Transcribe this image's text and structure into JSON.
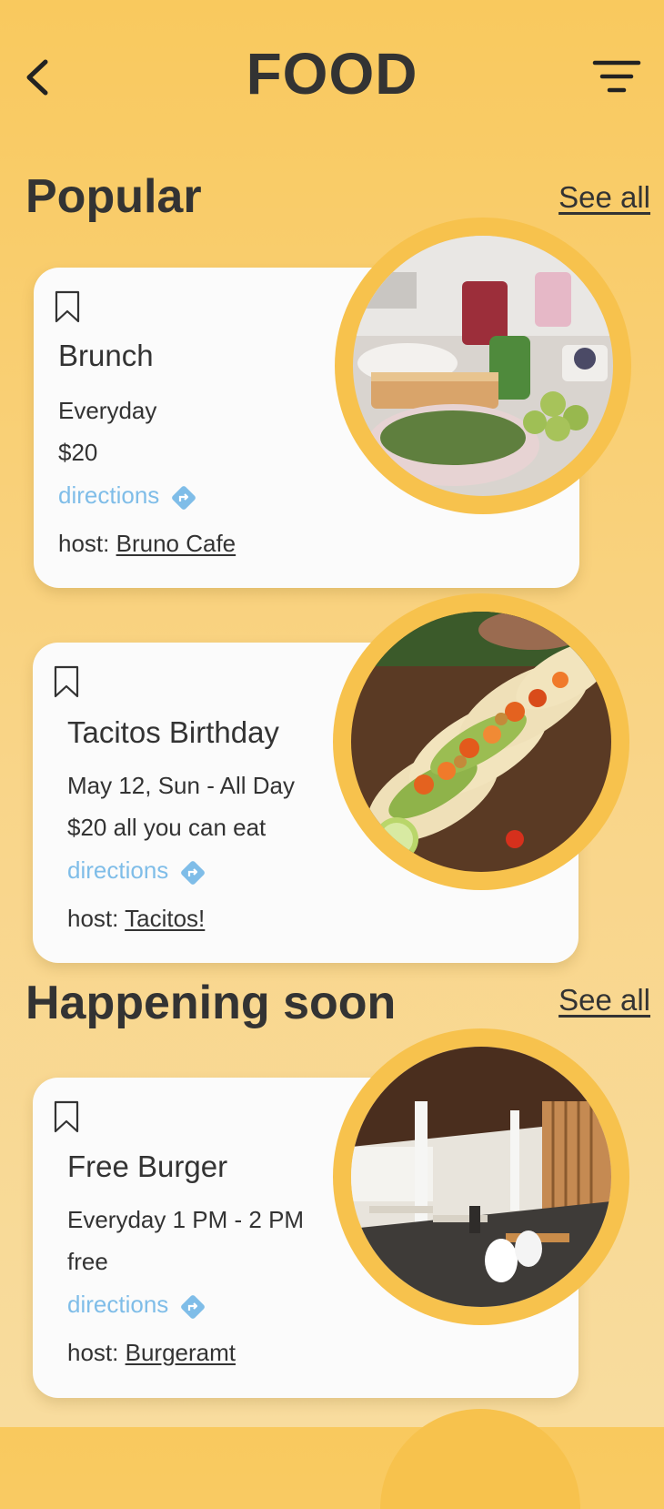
{
  "header": {
    "title": "FOOD",
    "back_icon": "chevron-left-icon",
    "filter_icon": "filter-icon"
  },
  "sections": [
    {
      "title": "Popular",
      "see_all": "See all"
    },
    {
      "title": "Happening soon",
      "see_all": "See all"
    }
  ],
  "cards": [
    {
      "title": "Brunch",
      "when": "Everyday",
      "price": "$20",
      "directions": "directions",
      "host_label": "host:",
      "host_name": "Bruno Cafe",
      "photo": "brunch-table-photo"
    },
    {
      "title": "Tacitos Birthday",
      "when": "May 12, Sun - All Day",
      "price": "$20 all you can eat",
      "directions": "directions",
      "host_label": "host:",
      "host_name": "Tacitos!",
      "photo": "tacos-photo"
    },
    {
      "title": "Free Burger",
      "when": "Everyday 1 PM - 2 PM",
      "price": "free",
      "directions": "directions",
      "host_label": "host:",
      "host_name": "Burgeramt",
      "photo": "restaurant-interior-photo"
    }
  ],
  "colors": {
    "background_top": "#f9c95e",
    "background_bottom": "#f8dc9e",
    "photo_ring": "#f7c24d",
    "directions_link": "#7fbde8",
    "text": "#333333"
  }
}
